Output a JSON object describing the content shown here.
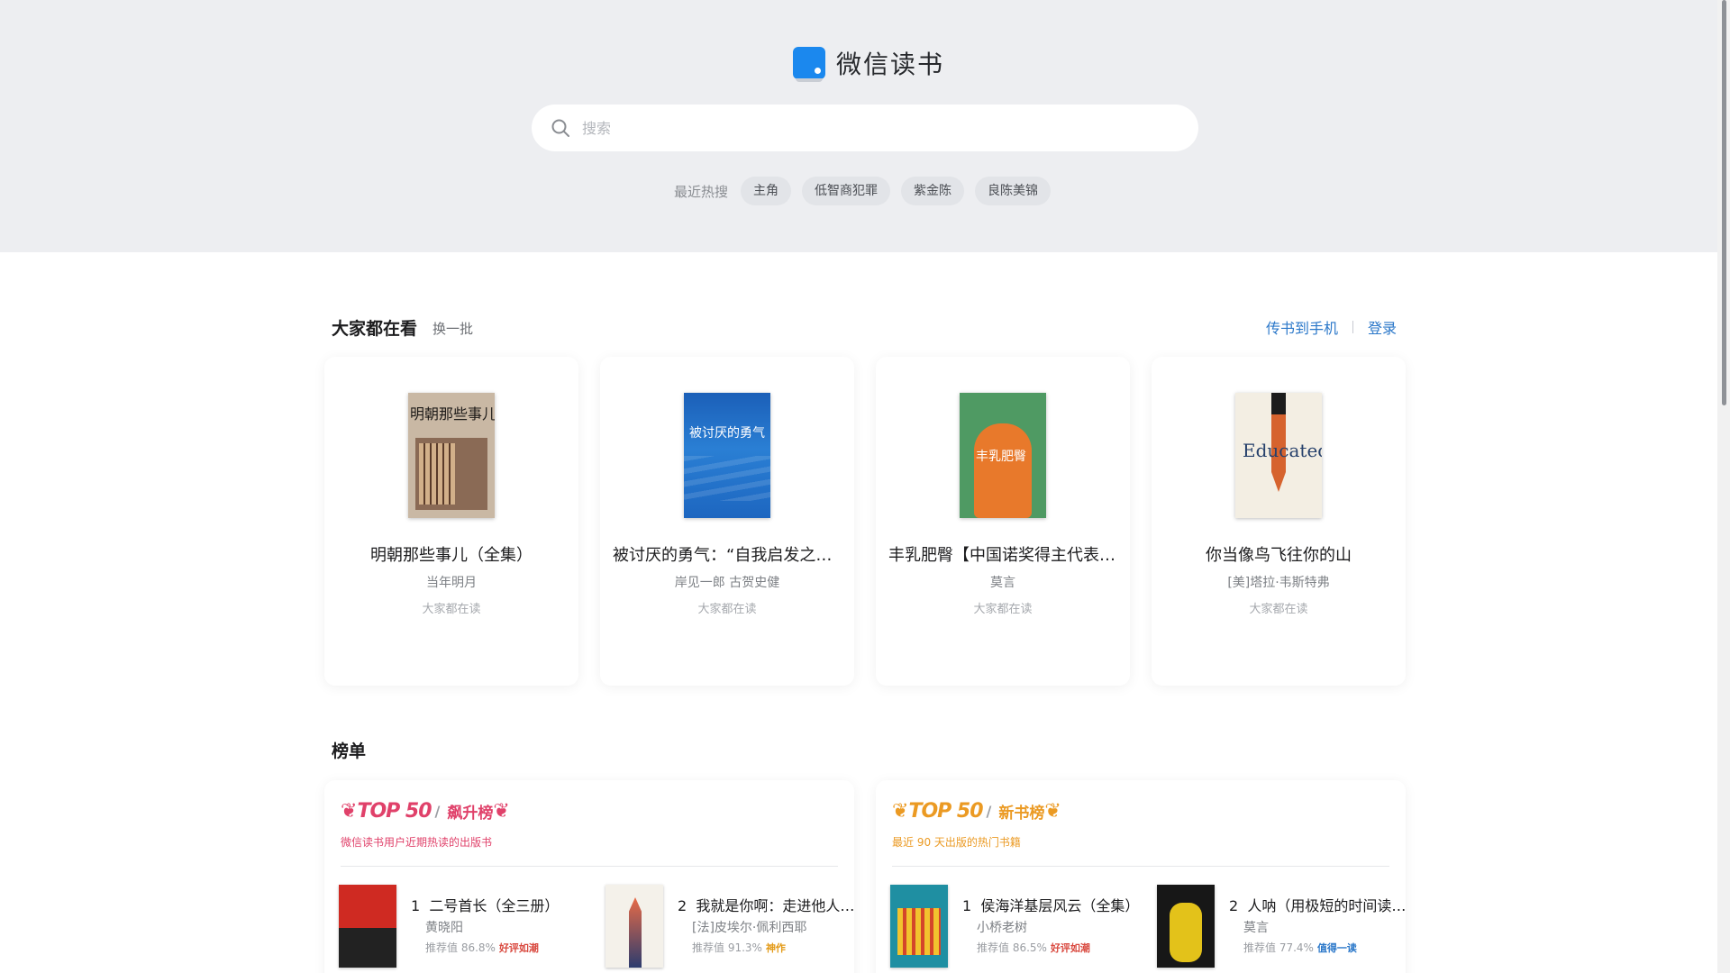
{
  "brand": {
    "name": "微信读书"
  },
  "search": {
    "placeholder": "搜索"
  },
  "hot_search": {
    "label": "最近热搜",
    "items": [
      "主角",
      "低智商犯罪",
      "紫金陈",
      "良陈美锦"
    ]
  },
  "everyone_reading": {
    "title": "大家都在看",
    "refresh_label": "换一批",
    "send_to_phone": "传书到手机",
    "login": "登录",
    "books": [
      {
        "title": "明朝那些事儿（全集）",
        "author": "当年明月",
        "meta": "大家都在读",
        "cover_text": "明朝那些事儿"
      },
      {
        "title": "被讨厌的勇气：“自我启发之父”阿德勒的哲学课",
        "author": "岸见一郎 古贺史健",
        "meta": "大家都在读",
        "cover_text": "被讨厌的勇气"
      },
      {
        "title": "丰乳肥臀【中国诺奖得主代表作】",
        "author": "莫言",
        "meta": "大家都在读",
        "cover_text": "丰乳肥臀"
      },
      {
        "title": "你当像鸟飞往你的山",
        "author": "[美]塔拉·韦斯特弗",
        "meta": "大家都在读",
        "cover_text": "Educated"
      }
    ]
  },
  "rankings": {
    "title": "榜单",
    "lists": [
      {
        "badge": "TOP 50",
        "name": "飙升榜",
        "subtitle": "微信读书用户近期热读的出版书",
        "color": "#e0416a",
        "items": [
          {
            "rank": "1",
            "title": "二号首长（全三册）",
            "author": "黄晓阳",
            "rate_label": "推荐值 86.8%",
            "tag": "好评如潮",
            "tag_color": "red"
          },
          {
            "rank": "2",
            "title": "我就是你啊：走进他人的心灵世界",
            "author": "[法]皮埃尔·佩利西耶",
            "rate_label": "推荐值 91.3%",
            "tag": "神作",
            "tag_color": "orange"
          }
        ]
      },
      {
        "badge": "TOP 50",
        "name": "新书榜",
        "subtitle": "最近 90 天出版的热门书籍",
        "color": "#eb9a23",
        "items": [
          {
            "rank": "1",
            "title": "侯海洋基层风云（全集）",
            "author": "小桥老树",
            "rate_label": "推荐值 86.5%",
            "tag": "好评如潮",
            "tag_color": "red"
          },
          {
            "rank": "2",
            "title": "人呐（用极短的时间读懂人性）",
            "author": "莫言",
            "rate_label": "推荐值 77.4%",
            "tag": "值得一读",
            "tag_color": "blue"
          }
        ]
      }
    ]
  }
}
